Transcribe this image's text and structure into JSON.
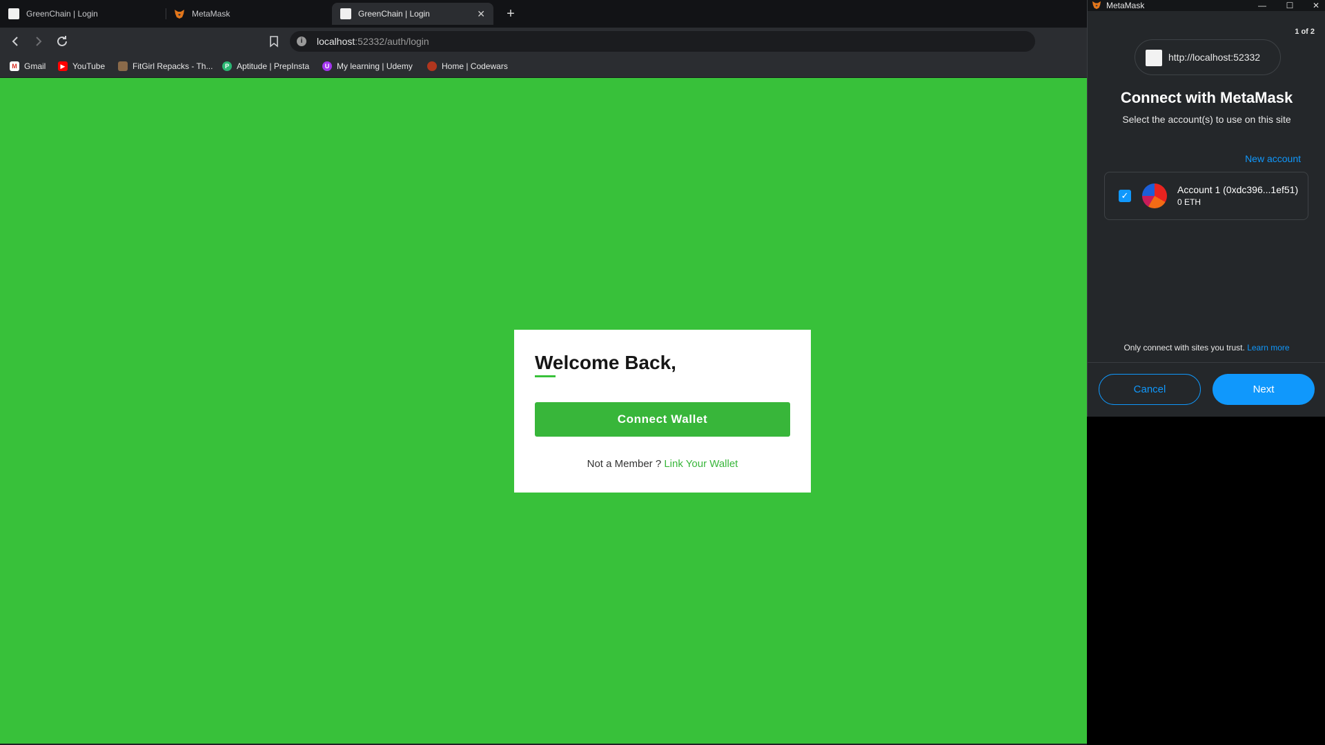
{
  "tabs": [
    {
      "title": "GreenChain | Login",
      "active": false
    },
    {
      "title": "MetaMask",
      "active": false
    },
    {
      "title": "GreenChain | Login",
      "active": true
    }
  ],
  "address_bar": {
    "host": "localhost",
    "rest": ":52332/auth/login"
  },
  "bookmarks": [
    {
      "label": "Gmail",
      "icon": "gmail-icon"
    },
    {
      "label": "YouTube",
      "icon": "youtube-icon"
    },
    {
      "label": "FitGirl Repacks - Th...",
      "icon": "fitgirl-icon"
    },
    {
      "label": "Aptitude | PrepInsta",
      "icon": "prepinsta-icon"
    },
    {
      "label": "My learning | Udemy",
      "icon": "udemy-icon"
    },
    {
      "label": "Home | Codewars",
      "icon": "codewars-icon"
    }
  ],
  "login": {
    "heading": "Welcome Back,",
    "connect_label": "Connect Wallet",
    "member_text": "Not a Member ?",
    "link_wallet": "Link Your Wallet"
  },
  "metamask": {
    "window_title": "MetaMask",
    "page_count": "1 of 2",
    "origin": "http://localhost:52332",
    "heading": "Connect with MetaMask",
    "subheading": "Select the account(s) to use on this site",
    "new_account": "New account",
    "account": {
      "name": "Account 1 (0xdc396...1ef51)",
      "balance": "0 ETH",
      "checked": true
    },
    "trust_text": "Only connect with sites you trust.",
    "learn_more": "Learn more",
    "cancel": "Cancel",
    "next": "Next"
  },
  "colors": {
    "page_background": "#38c13a",
    "primary_green": "#38b63a",
    "metamask_blue": "#1098fc"
  }
}
